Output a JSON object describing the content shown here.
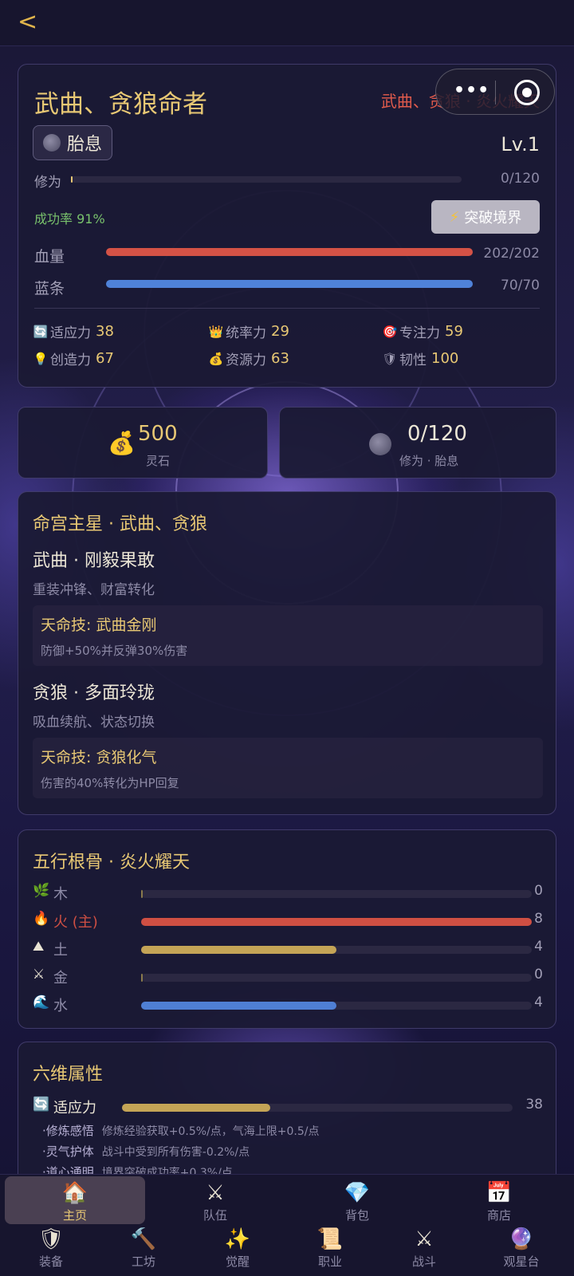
{
  "header": {
    "back": "<"
  },
  "profile": {
    "title": "武曲、贪狼命者",
    "tag": "武曲、贪狼 · 炎火耀天",
    "realm": "胎息",
    "level": "Lv.1",
    "cultivation_label": "修为",
    "cultivation_value": "0/120",
    "cultivation_fraction": 0.0,
    "success_rate": "成功率 91%",
    "breakthrough": "突破境界",
    "hp_label": "血量",
    "hp_value": "202/202",
    "hp_fraction": 1.0,
    "mp_label": "蓝条",
    "mp_value": "70/70",
    "mp_fraction": 1.0,
    "stats": [
      {
        "icon": "🔄",
        "name": "适应力",
        "value": "38"
      },
      {
        "icon": "👑",
        "name": "统率力",
        "value": "29"
      },
      {
        "icon": "🎯",
        "name": "专注力",
        "value": "59"
      },
      {
        "icon": "💡",
        "name": "创造力",
        "value": "67"
      },
      {
        "icon": "💰",
        "name": "资源力",
        "value": "63"
      },
      {
        "icon": "🛡",
        "name": "韧性",
        "value": "100"
      }
    ]
  },
  "resources": {
    "spirit_stone_value": "500",
    "spirit_stone_label": "灵石",
    "cultivation_value": "0/120",
    "cultivation_label": "修为 · 胎息"
  },
  "stars": {
    "title": "命宫主星 · 武曲、贪狼",
    "items": [
      {
        "name": "武曲 · 刚毅果敢",
        "desc": "重装冲锋、财富转化",
        "skill": "天命技: 武曲金刚",
        "skill_desc": "防御+50%并反弹30%伤害"
      },
      {
        "name": "贪狼 · 多面玲珑",
        "desc": "吸血续航、状态切换",
        "skill": "天命技: 贪狼化气",
        "skill_desc": "伤害的40%转化为HP回复"
      }
    ]
  },
  "elements": {
    "title": "五行根骨 · 炎火耀天",
    "max": 8,
    "items": [
      {
        "icon": "🌿",
        "name": "木",
        "value": 0,
        "color": "#8a7a4c"
      },
      {
        "icon": "🔥",
        "name": "火 (主)",
        "value": 8,
        "color": "#cf4f43",
        "main": true
      },
      {
        "icon": "⛰",
        "name": "土",
        "value": 4,
        "color": "#c4a456"
      },
      {
        "icon": "⚔",
        "name": "金",
        "value": 0,
        "color": "#8a7a4c"
      },
      {
        "icon": "🌊",
        "name": "水",
        "value": 4,
        "color": "#4f7fd4"
      }
    ]
  },
  "six": {
    "title": "六维属性",
    "attr_icon": "🔄",
    "attr_name": "适应力",
    "attr_value": "38",
    "attr_fraction": 0.38,
    "subs": [
      {
        "k": "·修炼感悟",
        "v": "修炼经验获取+0.5%/点，气海上限+0.5/点"
      },
      {
        "k": "·灵气护体",
        "v": "战斗中受到所有伤害-0.2%/点"
      },
      {
        "k": "·道心通明",
        "v": "境界突破成功率+0.3%/点"
      }
    ]
  },
  "nav": {
    "row1": [
      {
        "icon": "🏠",
        "label": "主页"
      },
      {
        "icon": "⚔",
        "label": "队伍"
      },
      {
        "icon": "💎",
        "label": "背包"
      },
      {
        "icon": "📅",
        "label": "商店"
      }
    ],
    "row2": [
      {
        "icon": "🛡",
        "label": "装备"
      },
      {
        "icon": "🔨",
        "label": "工坊"
      },
      {
        "icon": "✨",
        "label": "觉醒"
      },
      {
        "icon": "📜",
        "label": "职业"
      },
      {
        "icon": "⚔",
        "label": "战斗"
      },
      {
        "icon": "🔮",
        "label": "观星台"
      }
    ]
  },
  "colors": {
    "hp": "#d45246",
    "mp": "#4f82d9",
    "gold": "#e8c874",
    "track": "#2b2842"
  }
}
